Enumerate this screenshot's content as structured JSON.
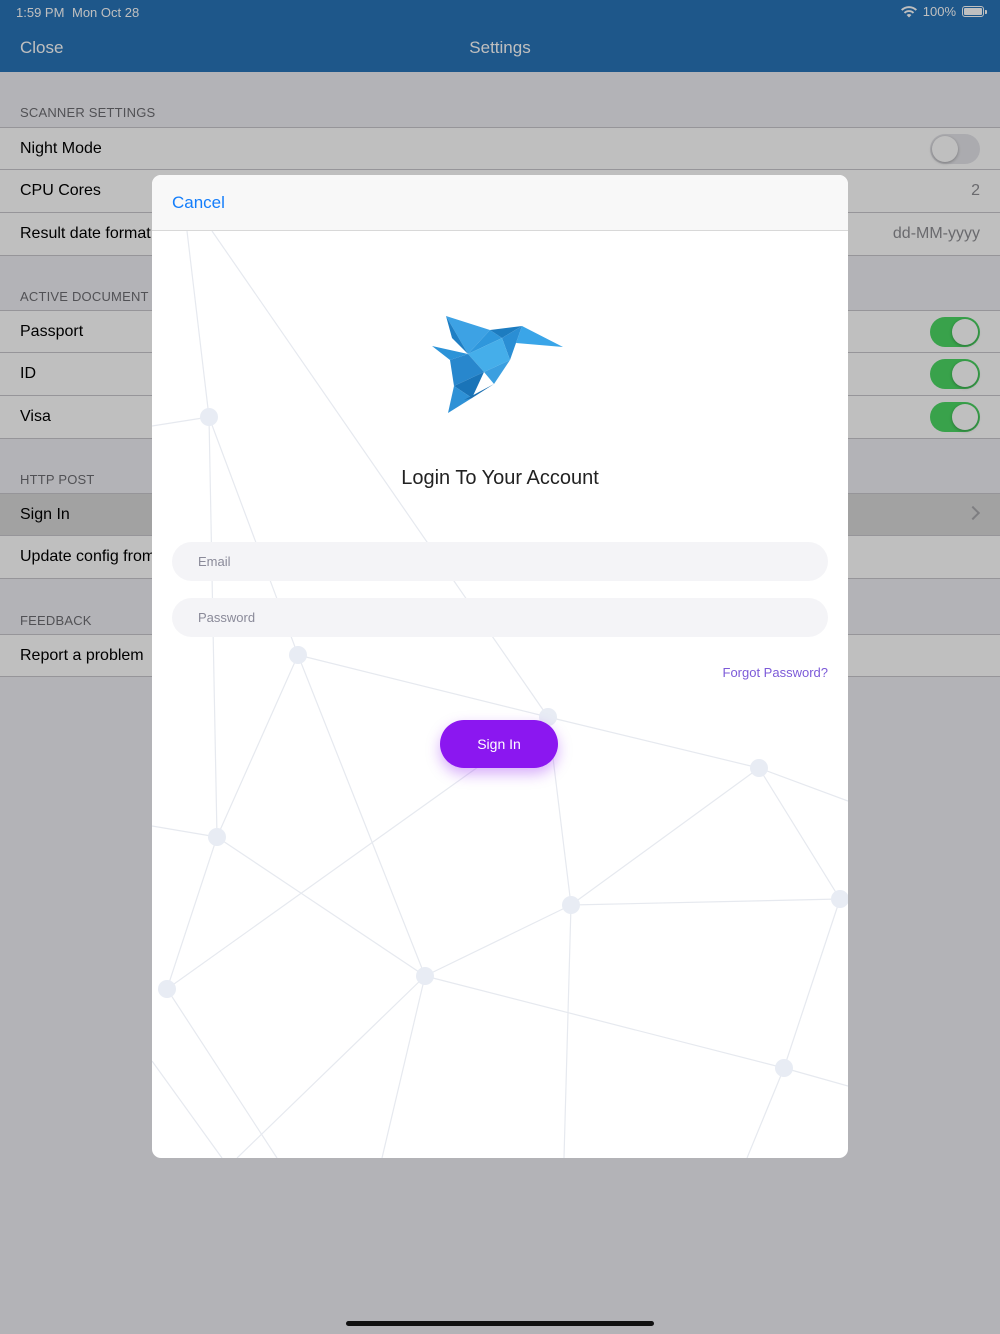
{
  "status_bar": {
    "time": "1:59 PM",
    "date": "Mon Oct 28",
    "battery": "100%",
    "wifi_icon": "wifi-icon",
    "battery_level": 1.0
  },
  "nav": {
    "close_label": "Close",
    "title": "Settings"
  },
  "sections": {
    "scanner": {
      "header": "SCANNER SETTINGS",
      "night_mode": {
        "label": "Night Mode",
        "on": false
      },
      "cpu_cores": {
        "label": "CPU Cores",
        "value": "2"
      },
      "date_format": {
        "label": "Result date format",
        "value": "dd-MM-yyyy"
      }
    },
    "documents": {
      "header": "ACTIVE DOCUMENT T",
      "passport": {
        "label": "Passport",
        "on": true
      },
      "id": {
        "label": "ID",
        "on": true
      },
      "visa": {
        "label": "Visa",
        "on": true
      }
    },
    "http_post": {
      "header": "HTTP POST",
      "sign_in": {
        "label": "Sign In"
      },
      "update_config": {
        "label": "Update config from"
      }
    },
    "feedback": {
      "header": "FEEDBACK",
      "report": {
        "label": "Report a problem"
      }
    }
  },
  "modal": {
    "cancel_label": "Cancel",
    "logo_icon": "origami-bird-logo-icon",
    "title": "Login To Your Account",
    "email_placeholder": "Email",
    "password_placeholder": "Password",
    "forgot_label": "Forgot Password?",
    "signin_label": "Sign In"
  },
  "colors": {
    "nav_bar": "#2874b8",
    "toggle_on": "#4cd964",
    "link_blue": "#147efb",
    "button_purple": "#8b17f0",
    "forgot_purple": "#7c5ad8"
  }
}
